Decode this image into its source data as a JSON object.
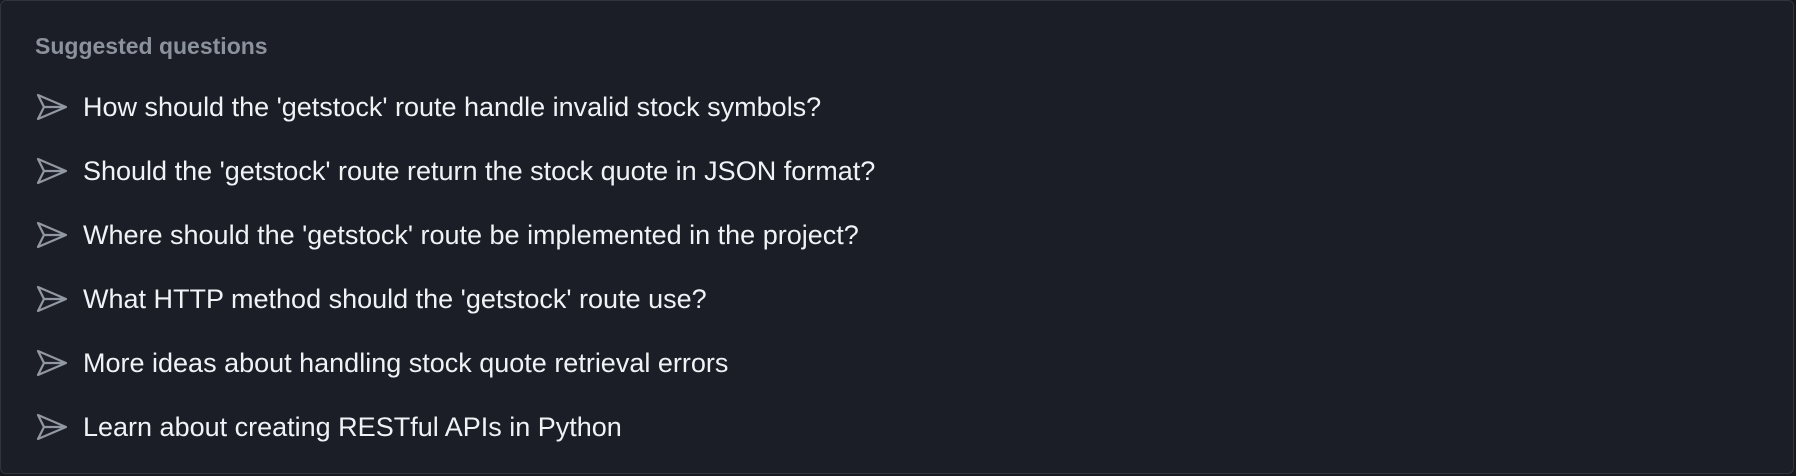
{
  "panel": {
    "heading": "Suggested questions",
    "items": [
      {
        "label": "How should the 'getstock' route handle invalid stock symbols?",
        "icon": "send-icon"
      },
      {
        "label": "Should the 'getstock' route return the stock quote in JSON format?",
        "icon": "send-icon"
      },
      {
        "label": "Where should the 'getstock' route be implemented in the project?",
        "icon": "send-icon"
      },
      {
        "label": "What HTTP method should the 'getstock' route use?",
        "icon": "send-icon"
      },
      {
        "label": "More ideas about handling stock quote retrieval errors",
        "icon": "send-icon"
      },
      {
        "label": "Learn about creating RESTful APIs in Python",
        "icon": "send-icon"
      }
    ]
  },
  "colors": {
    "background": "#1b1e26",
    "border": "#30343d",
    "heading": "#8b929c",
    "text": "#f0f3f6",
    "icon": "#9198a1"
  }
}
